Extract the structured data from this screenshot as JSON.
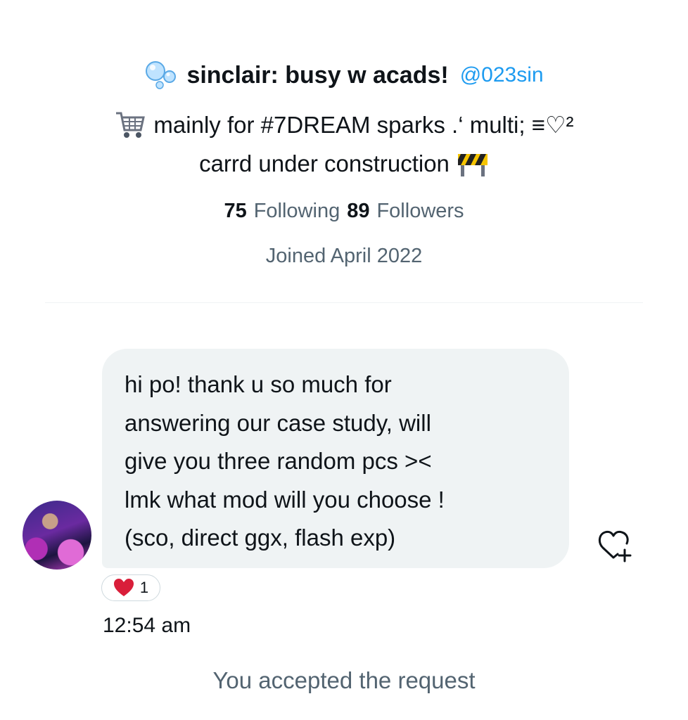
{
  "profile": {
    "emoji_left": "bubbles-icon",
    "display_name": "sinclair: busy w acads!",
    "handle": "@023sin",
    "bio_line1_icon": "shopping-cart-icon",
    "bio_line1": "mainly for #7DREAM sparks .‘ multi; ≡♡²",
    "bio_line2": "carrd under construction",
    "bio_line2_icon": "construction-icon",
    "following_count": "75",
    "following_label": "Following",
    "followers_count": "89",
    "followers_label": "Followers",
    "joined": "Joined April 2022"
  },
  "conversation": {
    "message_text": "hi po! thank u so much for\nanswering our case study, will\ngive you three random pcs ><\nlmk what mod will you choose !\n(sco, direct ggx, flash exp)",
    "reaction_emoji": "red-heart-icon",
    "reaction_count": "1",
    "timestamp": "12:54 am",
    "system_message": "You accepted the request"
  },
  "colors": {
    "handle_blue": "#1d9bf0",
    "bubble_gray": "#eff3f4",
    "secondary_text": "#536471",
    "heart_red": "#d91e3a"
  }
}
